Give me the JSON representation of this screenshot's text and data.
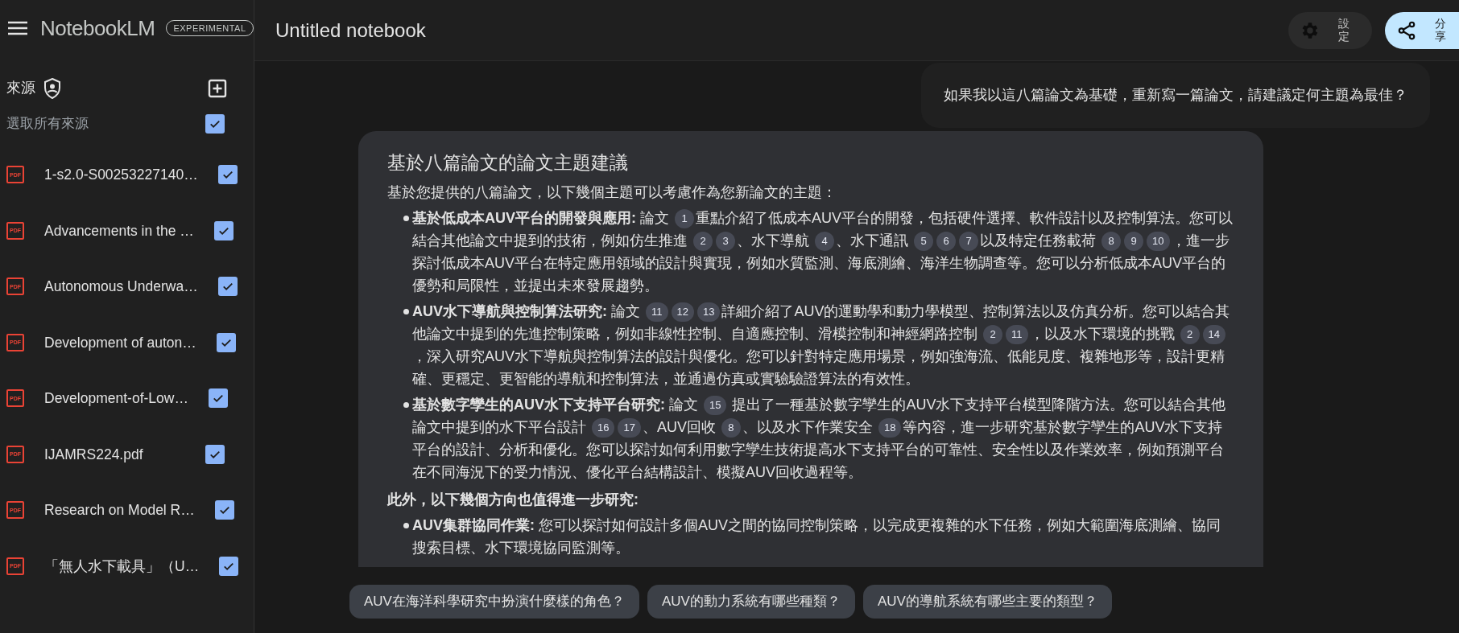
{
  "app": {
    "name": "NotebookLM",
    "badge": "EXPERIMENTAL"
  },
  "sources": {
    "title": "來源",
    "select_all": {
      "label": "選取所有來源",
      "checked": true
    },
    "items": [
      {
        "type_label": "PDF",
        "name": "1-s2.0-S00253227140…",
        "checked": true
      },
      {
        "type_label": "PDF",
        "name": "Advancements in the …",
        "checked": true
      },
      {
        "type_label": "PDF",
        "name": "Autonomous Underwa…",
        "checked": true
      },
      {
        "type_label": "PDF",
        "name": "Development of auton…",
        "checked": true
      },
      {
        "type_label": "PDF",
        "name": "Development-of-Low…",
        "checked": true
      },
      {
        "type_label": "PDF",
        "name": "IJAMRS224.pdf",
        "checked": true
      },
      {
        "type_label": "PDF",
        "name": "Research on Model R…",
        "checked": true
      },
      {
        "type_label": "PDF",
        "name": "「無人水下載具」（U…",
        "checked": true
      }
    ]
  },
  "notebook": {
    "title": "Untitled notebook",
    "buttons": [
      {
        "kind": "settings",
        "label": "設定"
      },
      {
        "kind": "share",
        "label": "分享"
      }
    ]
  },
  "question": "如果我以這八篇論文為基礎，重新寫一篇論文，請建議定何主題為最佳？",
  "answer": {
    "title": "基於八篇論文的論文主題建議",
    "blocks": [
      {
        "kind": "para",
        "parts": [
          {
            "kind": "text",
            "text": "基於您提供的八篇論文，以下幾個主題可以考慮作為您新論文的主題："
          }
        ]
      },
      {
        "kind": "bullet",
        "parts": [
          {
            "kind": "bold",
            "text": "基於低成本AUV平台的開發與應用:"
          },
          {
            "kind": "text",
            "text": " 論文 "
          },
          {
            "kind": "cite",
            "text": "1"
          },
          {
            "kind": "text",
            "text": "重點介紹了低成本AUV平台的開發，包括硬件選擇、軟件設計以及控制算法。您可以結合其他論文中提到的技術，例如仿生推進 "
          },
          {
            "kind": "cite",
            "text": "2"
          },
          {
            "kind": "cite",
            "text": "3"
          },
          {
            "kind": "text",
            "text": "、水下導航 "
          },
          {
            "kind": "cite",
            "text": "4"
          },
          {
            "kind": "text",
            "text": "、水下通訊 "
          },
          {
            "kind": "cite",
            "text": "5"
          },
          {
            "kind": "cite",
            "text": "6"
          },
          {
            "kind": "cite",
            "text": "7"
          },
          {
            "kind": "text",
            "text": "以及特定任務載荷 "
          },
          {
            "kind": "cite",
            "text": "8"
          },
          {
            "kind": "cite",
            "text": "9"
          },
          {
            "kind": "cite",
            "text": "10"
          },
          {
            "kind": "text",
            "text": "，進一步探討低成本AUV平台在特定應用領域的設計與實現，例如水質監測、海底測繪、海洋生物調查等。您可以分析低成本AUV平台的優勢和局限性，並提出未來發展趨勢。"
          }
        ]
      },
      {
        "kind": "bullet",
        "parts": [
          {
            "kind": "bold",
            "text": "AUV水下導航與控制算法研究:"
          },
          {
            "kind": "text",
            "text": " 論文 "
          },
          {
            "kind": "cite",
            "text": "11"
          },
          {
            "kind": "cite",
            "text": "12"
          },
          {
            "kind": "cite",
            "text": "13"
          },
          {
            "kind": "text",
            "text": "詳細介紹了AUV的運動學和動力學模型、控制算法以及仿真分析。您可以結合其他論文中提到的先進控制策略，例如非線性控制、自適應控制、滑模控制和神經網路控制 "
          },
          {
            "kind": "cite",
            "text": "2"
          },
          {
            "kind": "cite",
            "text": "11"
          },
          {
            "kind": "text",
            "text": "，以及水下環境的挑戰 "
          },
          {
            "kind": "cite",
            "text": "2"
          },
          {
            "kind": "cite",
            "text": "14"
          },
          {
            "kind": "text",
            "text": "，深入研究AUV水下導航與控制算法的設計與優化。您可以針對特定應用場景，例如強海流、低能見度、複雜地形等，設計更精確、更穩定、更智能的導航和控制算法，並通過仿真或實驗驗證算法的有效性。"
          }
        ]
      },
      {
        "kind": "bullet",
        "parts": [
          {
            "kind": "bold",
            "text": "基於數字孿生的AUV水下支持平台研究:"
          },
          {
            "kind": "text",
            "text": " 論文 "
          },
          {
            "kind": "cite",
            "text": "15"
          },
          {
            "kind": "text",
            "text": " 提出了一種基於數字孿生的AUV水下支持平台模型降階方法。您可以結合其他論文中提到的水下平台設計 "
          },
          {
            "kind": "cite",
            "text": "16"
          },
          {
            "kind": "cite",
            "text": "17"
          },
          {
            "kind": "text",
            "text": "、AUV回收 "
          },
          {
            "kind": "cite",
            "text": "8"
          },
          {
            "kind": "text",
            "text": "、以及水下作業安全 "
          },
          {
            "kind": "cite",
            "text": "18"
          },
          {
            "kind": "text",
            "text": "等內容，進一步研究基於數字孿生的AUV水下支持平台的設計、分析和優化。您可以探討如何利用數字孿生技術提高水下支持平台的可靠性、安全性以及作業效率，例如預測平台在不同海況下的受力情況、優化平台結構設計、模擬AUV回收過程等。"
          }
        ]
      },
      {
        "kind": "heading",
        "parts": [
          {
            "kind": "bold",
            "text": "此外，以下幾個方向也值得進一步研究:"
          }
        ]
      },
      {
        "kind": "bullet",
        "parts": [
          {
            "kind": "bold",
            "text": "AUV集群協同作業:"
          },
          {
            "kind": "text",
            "text": " 您可以探討如何設計多個AUV之間的協同控制策略，以完成更複雜的水下任務，例如大範圍海底測繪、協同搜索目標、水下環境協同監測等。"
          }
        ]
      }
    ]
  },
  "suggestions": [
    "AUV在海洋科學研究中扮演什麼樣的角色？",
    "AUV的動力系統有哪些種類？",
    "AUV的導航系統有哪些主要的類型？"
  ]
}
